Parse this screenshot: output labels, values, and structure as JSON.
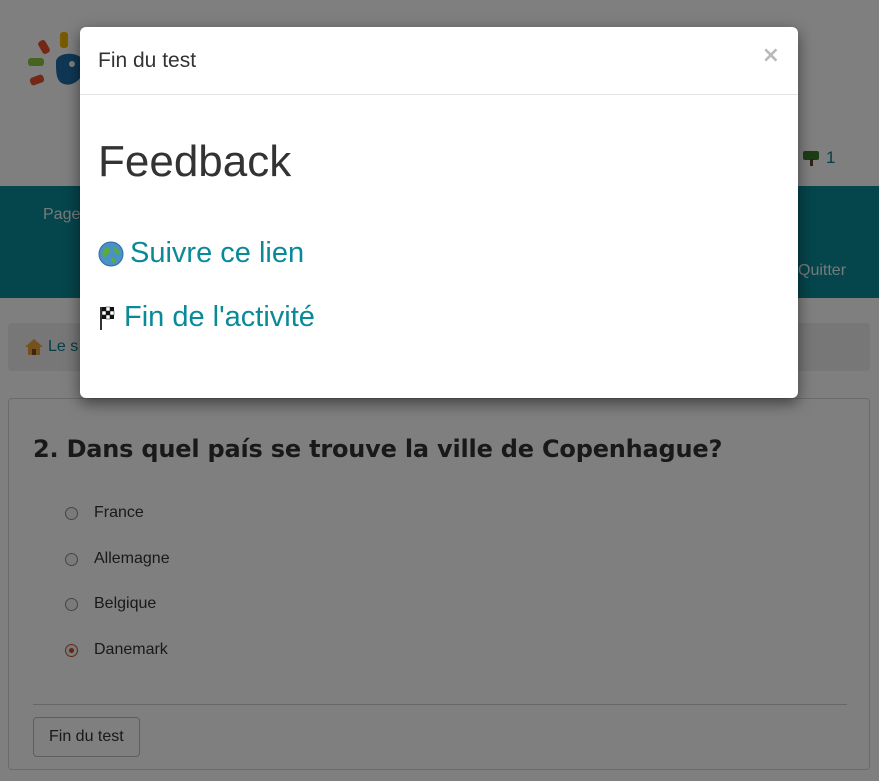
{
  "header": {
    "user_count": "1"
  },
  "nav": {
    "home_label": "Page",
    "quit_label": "Quitter"
  },
  "breadcrumb": {
    "label": "Le s"
  },
  "question": {
    "title": "2. Dans quel país se trouve la ville de Copenhague?",
    "options": [
      {
        "label": "France",
        "checked": false
      },
      {
        "label": "Allemagne",
        "checked": false
      },
      {
        "label": "Belgique",
        "checked": false
      },
      {
        "label": "Danemark",
        "checked": true
      }
    ],
    "finish_label": "Fin du test"
  },
  "modal": {
    "title": "Fin du test",
    "close_label": "×",
    "heading": "Feedback",
    "links": [
      {
        "label": "Suivre ce lien",
        "icon": "globe-icon"
      },
      {
        "label": "Fin de l'activité",
        "icon": "checkered-flag-icon"
      }
    ]
  },
  "colors": {
    "accent": "#0a8a99",
    "radio_checked": "#c24f2a"
  }
}
